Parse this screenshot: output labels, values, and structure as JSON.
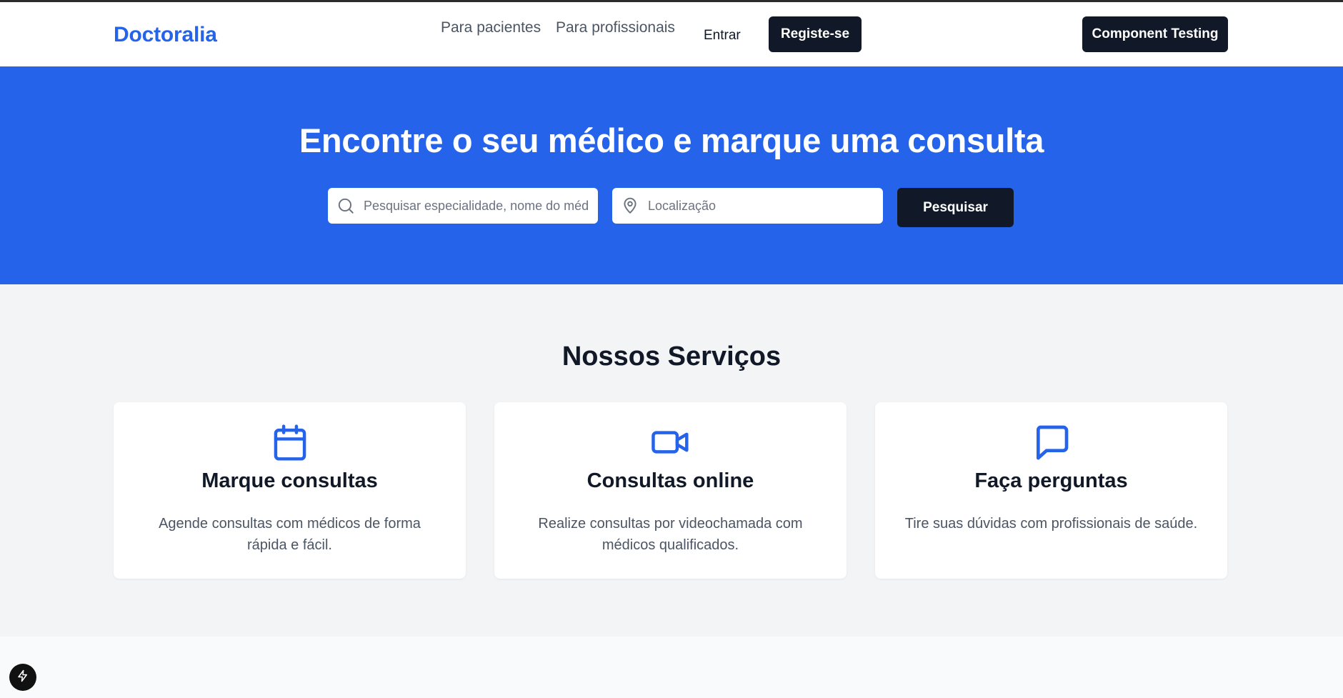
{
  "header": {
    "logo": "Doctoralia",
    "nav": {
      "pacientes": "Para pacientes",
      "profissionais": "Para profissionais"
    },
    "entrar": "Entrar",
    "registe": "Registe-se",
    "component_testing": "Component Testing"
  },
  "hero": {
    "title": "Encontre o seu médico e marque uma consulta",
    "search_placeholder": "Pesquisar especialidade, nome do médico",
    "location_placeholder": "Localização",
    "search_button": "Pesquisar"
  },
  "services": {
    "title": "Nossos Serviços",
    "cards": [
      {
        "icon": "calendar-icon",
        "title": "Marque consultas",
        "description": "Agende consultas com médicos de forma rápida e fácil."
      },
      {
        "icon": "video-icon",
        "title": "Consultas online",
        "description": "Realize consultas por videochamada com médicos qualificados."
      },
      {
        "icon": "message-icon",
        "title": "Faça perguntas",
        "description": "Tire suas dúvidas com profissionais de saúde."
      }
    ]
  },
  "colors": {
    "brand": "#2563eb",
    "dark_button": "#111827",
    "services_bg": "#f3f4f6"
  }
}
